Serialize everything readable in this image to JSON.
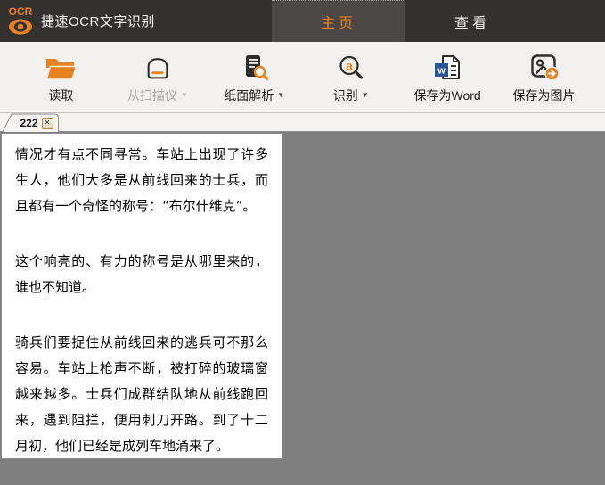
{
  "app": {
    "logo_text": "OCR",
    "title": "捷速OCR文字识别"
  },
  "nav": {
    "tabs": [
      {
        "label": "主页",
        "active": true
      },
      {
        "label": "查看",
        "active": false
      }
    ]
  },
  "toolbar": {
    "dropdown_glyph": "▼",
    "buttons": [
      {
        "label": "读取",
        "icon": "open-folder-icon",
        "enabled": true,
        "dropdown": false
      },
      {
        "label": "从扫描仪",
        "icon": "scanner-icon",
        "enabled": false,
        "dropdown": true
      },
      {
        "label": "纸面解析",
        "icon": "page-analysis-icon",
        "enabled": true,
        "dropdown": true
      },
      {
        "label": "识别",
        "icon": "recognize-icon",
        "enabled": true,
        "dropdown": true
      },
      {
        "label": "保存为Word",
        "icon": "save-word-icon",
        "enabled": true,
        "dropdown": false
      },
      {
        "label": "保存为图片",
        "icon": "save-image-icon",
        "enabled": true,
        "dropdown": false
      }
    ],
    "icon_letters": {
      "word": "w",
      "recognize": "a"
    }
  },
  "doc_tabs": {
    "active": {
      "label": "222",
      "close_glyph": "✕"
    }
  },
  "page": {
    "paragraphs": [
      "情况才有点不同寻常。车站上出现了许多生人，他们大多是从前线回来的士兵，而且都有一个奇怪的称号：“布尔什维克”。",
      "这个响亮的、有力的称号是从哪里来的，谁也不知道。",
      "骑兵们要捉住从前线回来的逃兵可不那么容易。车站上枪声不断，被打碎的玻璃窗越来越多。士兵们成群结队地从前线跑回来，遇到阻拦，便用刺刀开路。到了十二月初，他们已经是成列车地涌来了。"
    ]
  },
  "colors": {
    "accent_orange": "#e8821e",
    "titlebar_bg": "#343230",
    "active_tab_bg": "#4a4744",
    "toolbar_bg": "#f2f1ef",
    "canvas_bg": "#7f7f7f",
    "word_blue": "#2b579a"
  }
}
